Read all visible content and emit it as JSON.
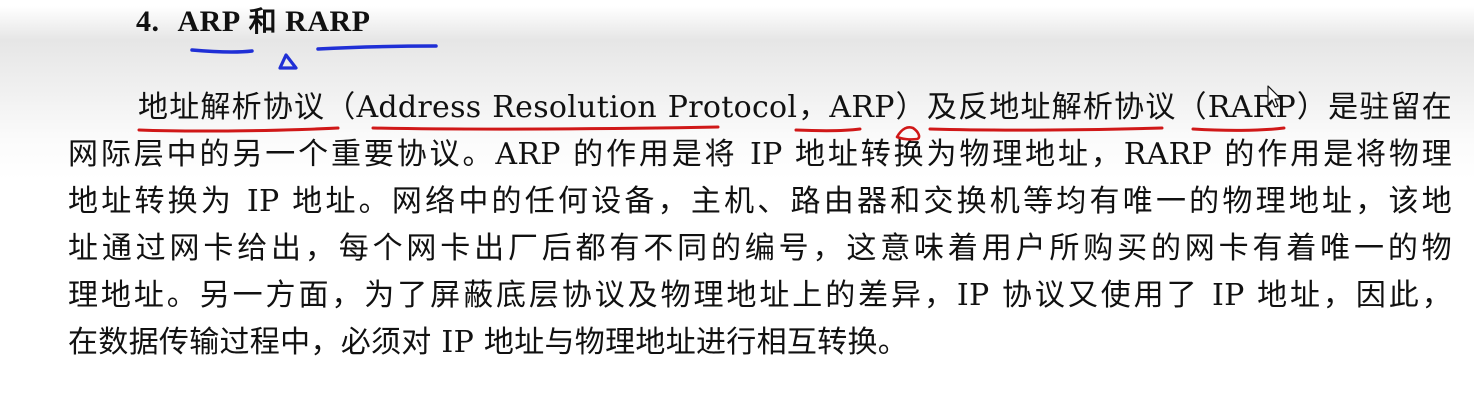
{
  "heading": {
    "number": "4.",
    "term1": "ARP",
    "connector": "和",
    "term2": "RARP"
  },
  "paragraph": {
    "lines": [
      "地址解析协议（Address Resolution Protocol，ARP）及反地址解析协议（RARP）是驻留在",
      "网际层中的另一个重要协议。ARP 的作用是将 IP 地址转换为物理地址，RARP 的作用是将物理",
      "地址转换为 IP 地址。网络中的任何设备，主机、路由器和交换机等均有唯一的物理地址，该地",
      "址通过网卡给出，每个网卡出厂后都有不同的编号，这意味着用户所购买的网卡有着唯一的物",
      "理地址。另一方面，为了屏蔽底层协议及物理地址上的差异，IP 协议又使用了 IP 地址，因此，",
      "在数据传输过程中，必须对 IP 地址与物理地址进行相互转换。"
    ]
  },
  "annotations": {
    "heading_ink_color": "#1f2fd6",
    "body_ink_color": "#d01818"
  }
}
